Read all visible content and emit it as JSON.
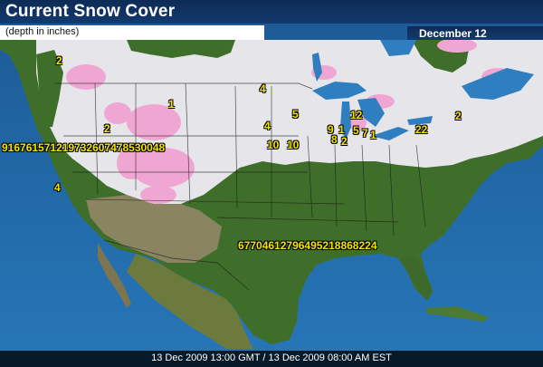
{
  "header": {
    "title": "Current Snow Cover",
    "subtitle": "(depth in inches)",
    "date": "December 12"
  },
  "footer": {
    "timestamp": "13 Dec 2009 13:00 GMT / 13 Dec 2009 08:00 AM EST"
  },
  "colors": {
    "ocean": "#1f5f9a",
    "land_forest": "#3f6e2a",
    "land_dry": "#8a8460",
    "snow": "#e6e6ea",
    "deep_snow": "#f0a6d2",
    "lakes": "#2f7fc0",
    "label": "#f2e600",
    "title_bar": "#0d2b56"
  },
  "depth_labels": [
    {
      "id": "ca-mtn",
      "text": "4"
    },
    {
      "id": "or",
      "text": "2"
    },
    {
      "id": "nw-band",
      "text": "2"
    },
    {
      "id": "wy",
      "text": "1"
    },
    {
      "id": "west-row",
      "text": "916761571219732607478530048"
    },
    {
      "id": "dakota",
      "text": "4"
    },
    {
      "id": "mn",
      "text": "5"
    },
    {
      "id": "ia",
      "text": "4"
    },
    {
      "id": "ne-a",
      "text": "10"
    },
    {
      "id": "ne-b",
      "text": "10"
    },
    {
      "id": "wi-a",
      "text": "9"
    },
    {
      "id": "wi-b",
      "text": "1"
    },
    {
      "id": "il-a",
      "text": "8"
    },
    {
      "id": "il-b",
      "text": "2"
    },
    {
      "id": "mi",
      "text": "12"
    },
    {
      "id": "mi-a",
      "text": "5"
    },
    {
      "id": "mi-b",
      "text": "7"
    },
    {
      "id": "mi-c",
      "text": "1"
    },
    {
      "id": "oh",
      "text": "22"
    },
    {
      "id": "ne-us",
      "text": "2"
    },
    {
      "id": "south-row",
      "text": "67704612796495218868224"
    }
  ]
}
